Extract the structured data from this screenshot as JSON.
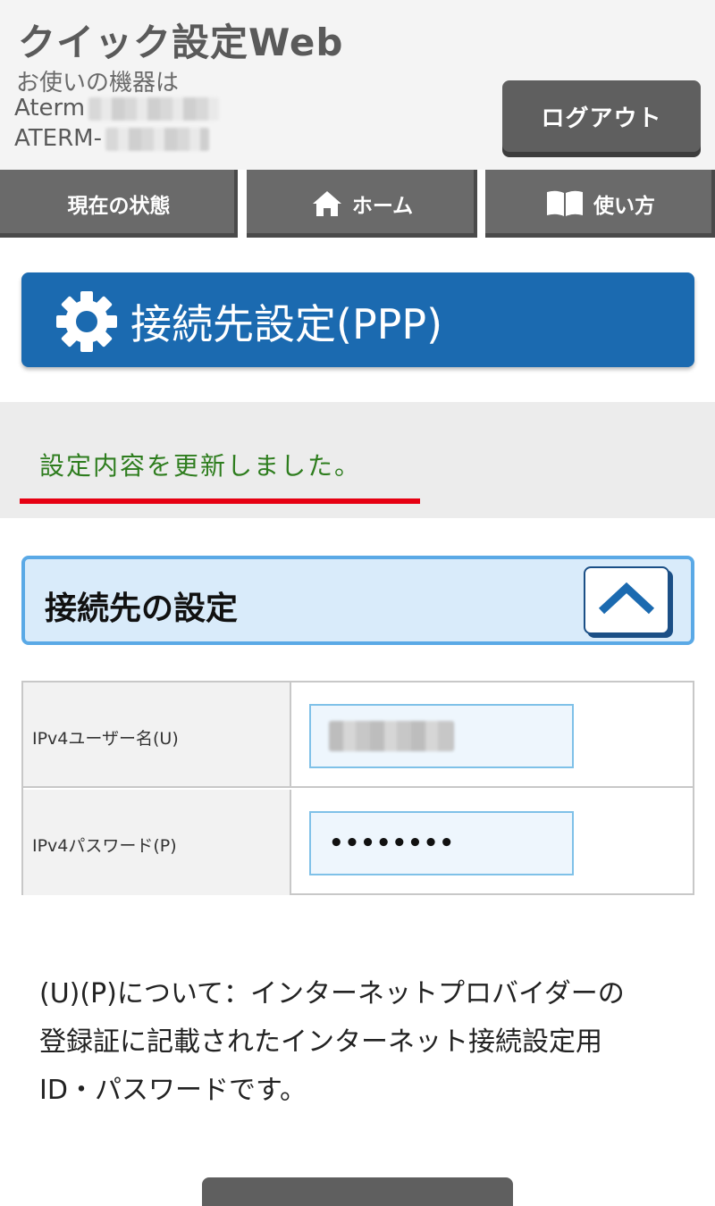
{
  "header": {
    "app_title": "クイック設定Web",
    "device_caption": "お使いの機器は",
    "device_model_prefix": "Aterm",
    "device_ssid_prefix": "ATERM-",
    "logout_label": "ログアウト"
  },
  "nav": {
    "items": [
      {
        "label": "現在の状態",
        "icon": ""
      },
      {
        "label": "ホーム",
        "icon": "home-icon"
      },
      {
        "label": "使い方",
        "icon": "book-icon"
      }
    ]
  },
  "page": {
    "title": "接続先設定(PPP)",
    "title_icon": "gear-icon",
    "title_bg": "#1b6ab0"
  },
  "message": {
    "text": "設定内容を更新しました。",
    "text_color": "#2e7d1e",
    "underline_color": "#e60012"
  },
  "section": {
    "title": "接続先の設定",
    "collapse_icon": "chevron-up-icon"
  },
  "form": {
    "rows": [
      {
        "label": "IPv4ユーザー名(U)",
        "value": ""
      },
      {
        "label": "IPv4パスワード(P)",
        "value": "••••••••"
      }
    ]
  },
  "note": {
    "line1": "(U)(P)について：インターネットプロバイダーの",
    "line2": "登録証に記載されたインターネット接続設定用",
    "line3": "ID・パスワードです。"
  }
}
